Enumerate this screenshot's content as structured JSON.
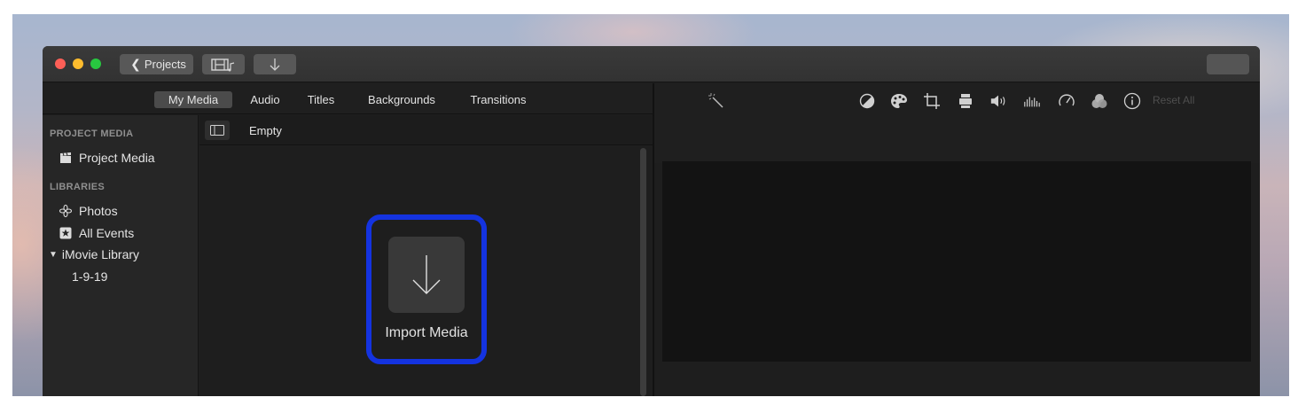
{
  "titlebar": {
    "projects_label": "Projects"
  },
  "tabs": [
    {
      "label": "My Media"
    },
    {
      "label": "Audio"
    },
    {
      "label": "Titles"
    },
    {
      "label": "Backgrounds"
    },
    {
      "label": "Transitions"
    }
  ],
  "sidebar": {
    "project_media_header": "PROJECT MEDIA",
    "project_media_item": "Project Media",
    "libraries_header": "LIBRARIES",
    "photos_item": "Photos",
    "all_events_item": "All Events",
    "library_item": "iMovie Library",
    "event_item": "1-9-19"
  },
  "content": {
    "filter_label": "Empty",
    "import_label": "Import Media"
  },
  "viewer_toolbar": {
    "reset_label": "Reset All",
    "icons": [
      "magic-wand-icon",
      "color-balance-icon",
      "color-correction-icon",
      "crop-icon",
      "stabilization-icon",
      "volume-icon",
      "noise-reduction-icon",
      "speed-icon",
      "clip-filter-icon",
      "info-icon"
    ]
  },
  "colors": {
    "highlight": "#1433e0",
    "traffic_red": "#fd5f57",
    "traffic_yellow": "#febc2e",
    "traffic_green": "#28c840"
  }
}
